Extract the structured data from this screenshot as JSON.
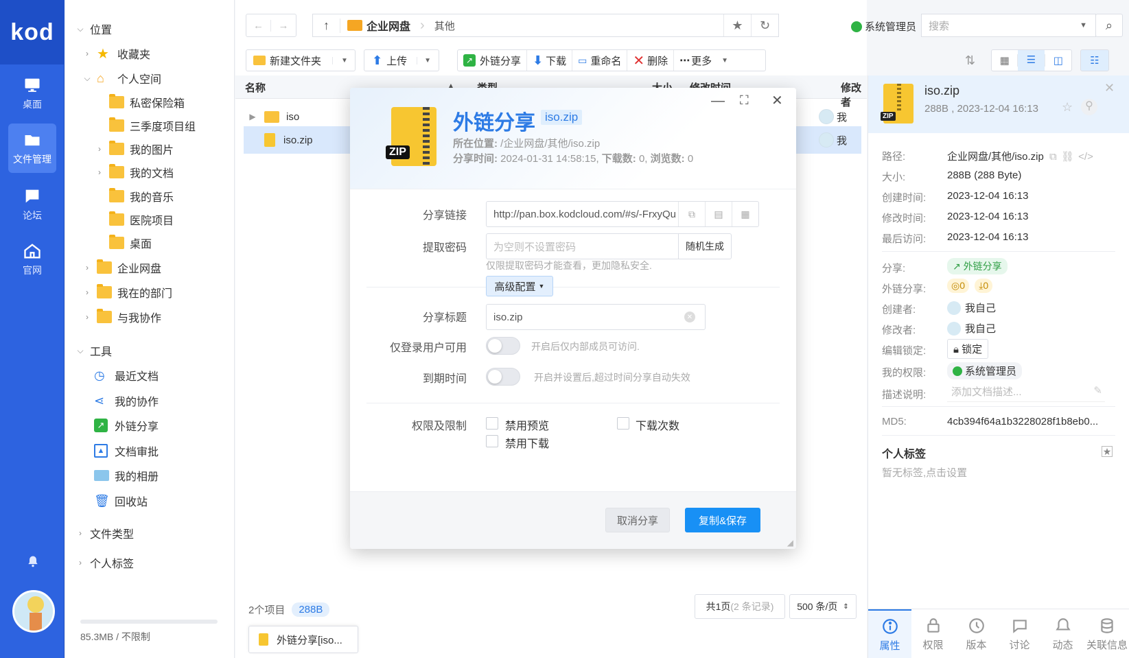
{
  "nav": {
    "logo": "kod",
    "items": [
      {
        "label": "桌面"
      },
      {
        "label": "文件管理"
      },
      {
        "label": "论坛"
      },
      {
        "label": "官网"
      }
    ]
  },
  "tree": {
    "location_header": "位置",
    "items": [
      {
        "label": "收藏夹"
      },
      {
        "label": "个人空间"
      },
      {
        "label": "私密保险箱"
      },
      {
        "label": "三季度项目组"
      },
      {
        "label": "我的图片"
      },
      {
        "label": "我的文档"
      },
      {
        "label": "我的音乐"
      },
      {
        "label": "医院项目"
      },
      {
        "label": "桌面"
      },
      {
        "label": "企业网盘"
      },
      {
        "label": "我在的部门"
      },
      {
        "label": "与我协作"
      }
    ],
    "tools_header": "工具",
    "tools": [
      {
        "label": "最近文档"
      },
      {
        "label": "我的协作"
      },
      {
        "label": "外链分享"
      },
      {
        "label": "文档审批"
      },
      {
        "label": "我的相册"
      },
      {
        "label": "回收站"
      }
    ],
    "file_types": "文件类型",
    "personal_tags": "个人标签",
    "storage": "85.3MB / 不限制"
  },
  "toolbar": {
    "crumbs": [
      "企业网盘",
      "其他"
    ],
    "user": "系统管理员",
    "search_placeholder": "搜索",
    "new_folder": "新建文件夹",
    "upload": "上传",
    "share": "外链分享",
    "download": "下载",
    "rename": "重命名",
    "delete": "删除",
    "more": "更多"
  },
  "table": {
    "columns": [
      "名称",
      "类型",
      "大小",
      "修改时间",
      "修改者"
    ],
    "rows": [
      {
        "name": "iso",
        "modifier": "我"
      },
      {
        "name": "iso.zip",
        "modifier": "我"
      }
    ],
    "item_count": "2个项目",
    "size_badge": "288B",
    "pager": "共1页",
    "pager_records": "(2 条记录)",
    "per_page": "500 条/页",
    "taskbar": "外链分享[iso..."
  },
  "dialog": {
    "title": "外链分享",
    "file_badge": "iso.zip",
    "location_label": "所在位置:",
    "location_value": "/企业网盘/其他/iso.zip",
    "share_time_label": "分享时间:",
    "share_time": "2024-01-31 14:58:15,",
    "downloads_label": "下载数:",
    "downloads": "0,",
    "views_label": "浏览数:",
    "views": "0",
    "link_label": "分享链接",
    "link_value": "http://pan.box.kodcloud.com/#s/-FrxyQu",
    "pwd_label": "提取密码",
    "pwd_placeholder": "为空则不设置密码",
    "random": "随机生成",
    "pwd_hint": "仅限提取密码才能查看，更加隐私安全.",
    "advanced": "高级配置",
    "title_label": "分享标题",
    "title_value": "iso.zip",
    "login_label": "仅登录用户可用",
    "login_hint": "开启后仅内部成员可访问.",
    "expire_label": "到期时间",
    "expire_hint": "开启并设置后,超过时间分享自动失效",
    "perm_label": "权限及限制",
    "perm_preview": "禁用预览",
    "perm_download": "禁用下载",
    "perm_count": "下载次数",
    "cancel": "取消分享",
    "save": "复制&保存"
  },
  "detail": {
    "name": "iso.zip",
    "meta": "288B , 2023-12-04 16:13",
    "rows": [
      {
        "k": "路径:",
        "v": "企业网盘/其他/iso.zip"
      },
      {
        "k": "大小:",
        "v": "288B (288 Byte)"
      },
      {
        "k": "创建时间:",
        "v": "2023-12-04 16:13"
      },
      {
        "k": "修改时间:",
        "v": "2023-12-04 16:13"
      },
      {
        "k": "最后访问:",
        "v": "2023-12-04 16:13"
      }
    ],
    "share_k": "分享:",
    "share_v": "外链分享",
    "link_share_k": "外链分享:",
    "link_views": "0",
    "link_downloads": "0",
    "creator_k": "创建者:",
    "creator_v": "我自己",
    "modifier_k": "修改者:",
    "modifier_v": "我自己",
    "lock_k": "编辑锁定:",
    "lock_v": "锁定",
    "perm_k": "我的权限:",
    "perm_v": "系统管理员",
    "desc_k": "描述说明:",
    "desc_placeholder": "添加文档描述...",
    "md5_k": "MD5:",
    "md5_v": "4cb394f64a1b3228028f1b8eb0...",
    "tags_title": "个人标签",
    "tags_hint": "暂无标签,点击设置",
    "tabs": [
      "属性",
      "权限",
      "版本",
      "讨论",
      "动态",
      "关联信息"
    ]
  },
  "colors": {
    "nav_blue": "#2d63e0",
    "accent": "#2d7be5",
    "share_green": "#2f9e44",
    "save_button": "#1890f5"
  }
}
